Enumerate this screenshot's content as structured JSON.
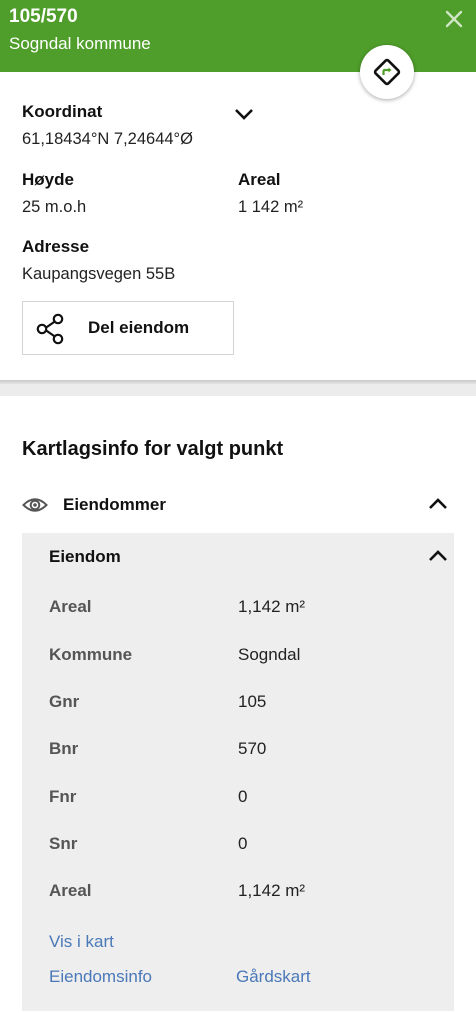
{
  "header": {
    "title": "105/570",
    "subtitle": "Sogndal kommune",
    "color": "#4f9e2b"
  },
  "property": {
    "coordinate_label": "Koordinat",
    "coordinate_value": "61,18434°N 7,24644°Ø",
    "height_label": "Høyde",
    "height_value": "25 m.o.h",
    "area_label": "Areal",
    "area_value": "1 142 m²",
    "address_label": "Adresse",
    "address_value": "Kaupangsvegen 55B",
    "share_label": "Del eiendom"
  },
  "layers": {
    "title": "Kartlagsinfo for valgt punkt",
    "layer_name": "Eiendommer",
    "panel_title": "Eiendom",
    "rows": [
      {
        "label": "Areal",
        "value": "1,142 m²"
      },
      {
        "label": "Kommune",
        "value": "Sogndal"
      },
      {
        "label": "Gnr",
        "value": "105"
      },
      {
        "label": "Bnr",
        "value": "570"
      },
      {
        "label": "Fnr",
        "value": "0"
      },
      {
        "label": "Snr",
        "value": "0"
      },
      {
        "label": "Areal",
        "value": "1,142 m²"
      }
    ],
    "links": {
      "show_in_map": "Vis i kart",
      "property_info": "Eiendomsinfo",
      "farm_map": "Gårdskart"
    },
    "link_color": "#4a78b8"
  },
  "icons": {
    "close": "close-icon",
    "route": "route-icon",
    "share": "share-icon",
    "visibility": "eye-icon",
    "expand": "chevron-down-icon",
    "collapse": "chevron-up-icon"
  }
}
